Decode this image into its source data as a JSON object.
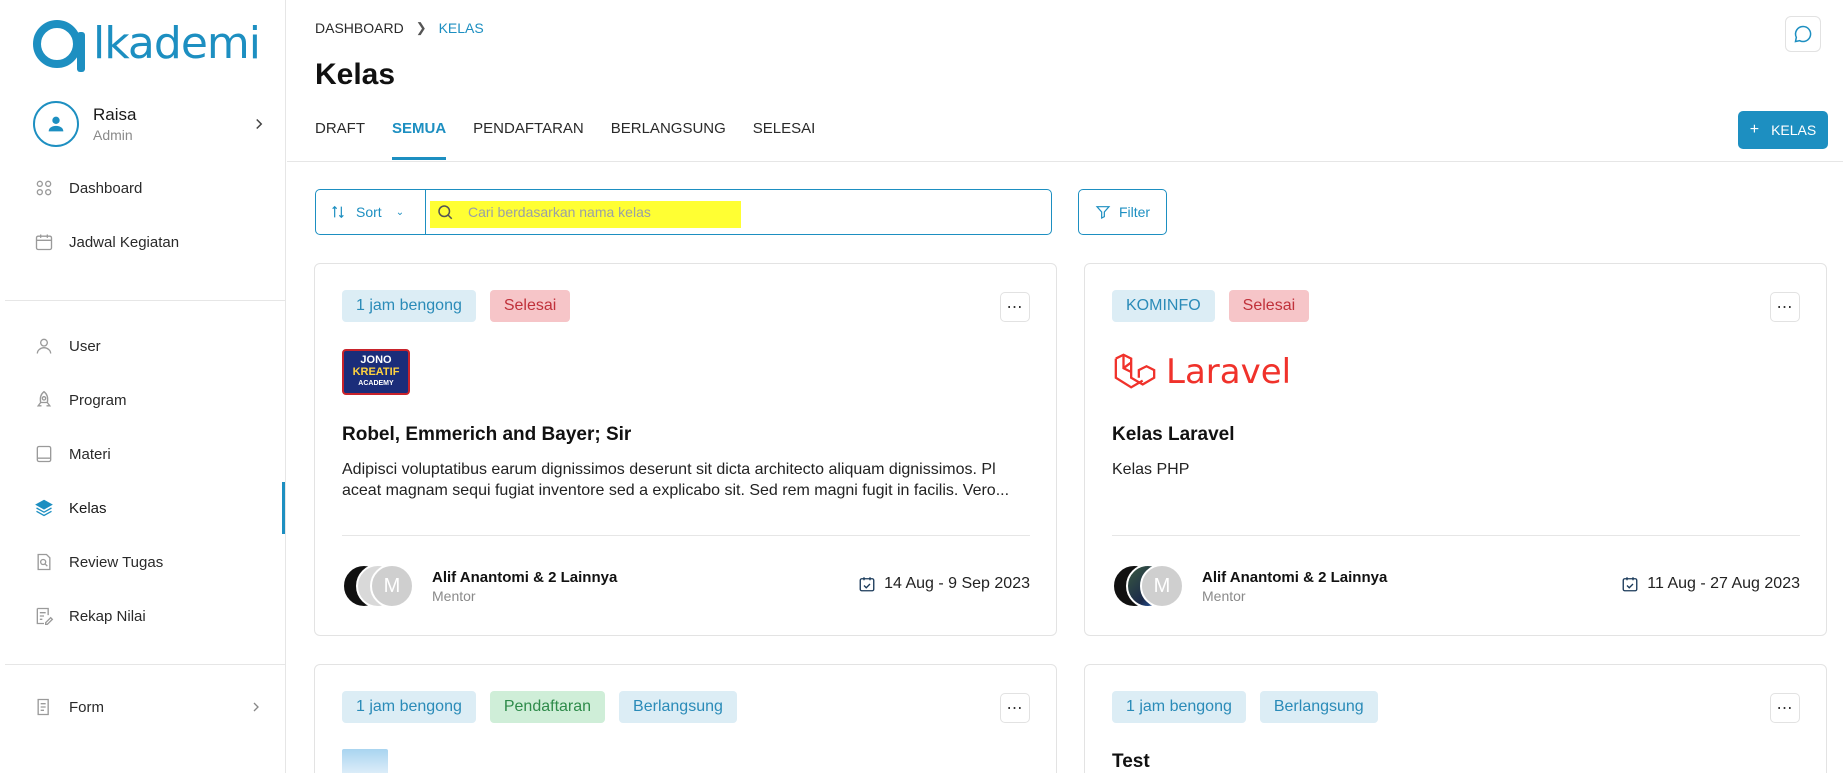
{
  "brand": {
    "logo_text": "lkademi",
    "accent": "#1d8fc1"
  },
  "profile": {
    "name": "Raisa",
    "role": "Admin"
  },
  "sidebar": {
    "items": [
      {
        "label": "Dashboard",
        "icon": "grid-icon"
      },
      {
        "label": "Jadwal Kegiatan",
        "icon": "calendar-icon"
      },
      {
        "label": "User",
        "icon": "user-icon"
      },
      {
        "label": "Program",
        "icon": "rocket-icon"
      },
      {
        "label": "Materi",
        "icon": "book-icon"
      },
      {
        "label": "Kelas",
        "icon": "layers-icon",
        "active": true
      },
      {
        "label": "Review Tugas",
        "icon": "review-icon"
      },
      {
        "label": "Rekap Nilai",
        "icon": "edit-list-icon"
      },
      {
        "label": "Form",
        "icon": "form-icon"
      }
    ]
  },
  "breadcrumb": {
    "root": "DASHBOARD",
    "current": "KELAS"
  },
  "page": {
    "title": "Kelas"
  },
  "tabs": [
    {
      "label": "DRAFT"
    },
    {
      "label": "SEMUA",
      "active": true
    },
    {
      "label": "PENDAFTARAN"
    },
    {
      "label": "BERLANGSUNG"
    },
    {
      "label": "SELESAI"
    }
  ],
  "toolbar": {
    "add_label": "KELAS",
    "sort_label": "Sort",
    "search_placeholder": "Cari berdasarkan nama kelas",
    "filter_label": "Filter"
  },
  "cards": [
    {
      "badges": [
        "1 jam bengong",
        "Selesai"
      ],
      "logo_lines": [
        "JONO",
        "KREATIF",
        "ACADEMY"
      ],
      "title": "Robel, Emmerich and Bayer; Sir",
      "desc_line1": "Adipisci voluptatibus earum dignissimos deserunt sit dicta architecto aliquam dignissimos. Pl",
      "desc_line2": "aceat magnam sequi fugiat inventore sed a explicabo sit. Sed rem magni fugit in facilis. Vero...",
      "avatar_initial": "M",
      "mentor_name": "Alif Anantomi & 2 Lainnya",
      "mentor_role": "Mentor",
      "date": "14 Aug - 9 Sep 2023"
    },
    {
      "badges": [
        "KOMINFO",
        "Selesai"
      ],
      "logo_text": "Laravel",
      "title": "Kelas Laravel",
      "desc_line1": "Kelas PHP",
      "avatar_initial": "M",
      "mentor_name": "Alif Anantomi & 2 Lainnya",
      "mentor_role": "Mentor",
      "date": "11 Aug - 27 Aug 2023"
    },
    {
      "badges": [
        "1 jam bengong",
        "Pendaftaran",
        "Berlangsung"
      ]
    },
    {
      "badges": [
        "1 jam bengong",
        "Berlangsung"
      ],
      "title": "Test"
    }
  ],
  "colors": {
    "badge_blue_bg": "#dcedf5",
    "badge_red_bg": "#f6c5c8",
    "badge_green_bg": "#cfeed8",
    "search_highlight": "#ffff33"
  }
}
